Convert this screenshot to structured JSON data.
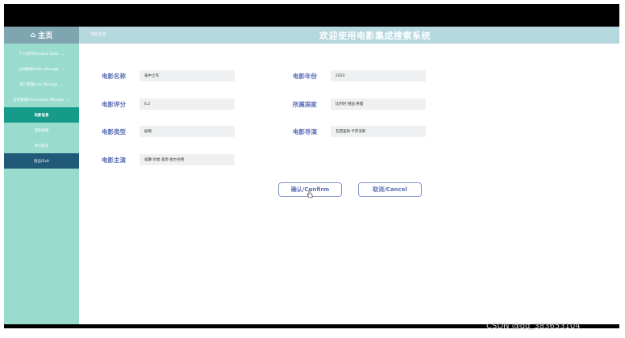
{
  "header": {
    "home_label": "主页",
    "breadcrumb": "电影信息",
    "title": "欢迎使用电影集成搜索系统"
  },
  "sidebar": {
    "items": [
      {
        "label": "个人资料Personal Data"
      },
      {
        "label": "公共数据Public Manage"
      },
      {
        "label": "用户管理User Manage"
      },
      {
        "label": "信息管理Information Manage"
      },
      {
        "label": "电影信息"
      },
      {
        "label": "电影搜索"
      },
      {
        "label": "评分排名"
      },
      {
        "label": "退出/Exit"
      }
    ]
  },
  "form": {
    "name_label": "电影名称",
    "name_value": "笼中之鸟",
    "year_label": "电影年份",
    "year_value": "2023",
    "rating_label": "电影评分",
    "rating_value": "6.2",
    "country_label": "所属国家",
    "country_value": "比利时 德国 希腊",
    "type_label": "电影类型",
    "type_value": "剧情",
    "director_label": "电影导演",
    "director_value": "瓦西里斯·卡苏洛斯",
    "cast_label": "电影主演",
    "cast_value": "威廉·达福 查恩·伯尔谷德"
  },
  "buttons": {
    "confirm": "确认/Confirm",
    "cancel": "取消/Cancel"
  },
  "watermark": "CSDN @qq_383653104"
}
